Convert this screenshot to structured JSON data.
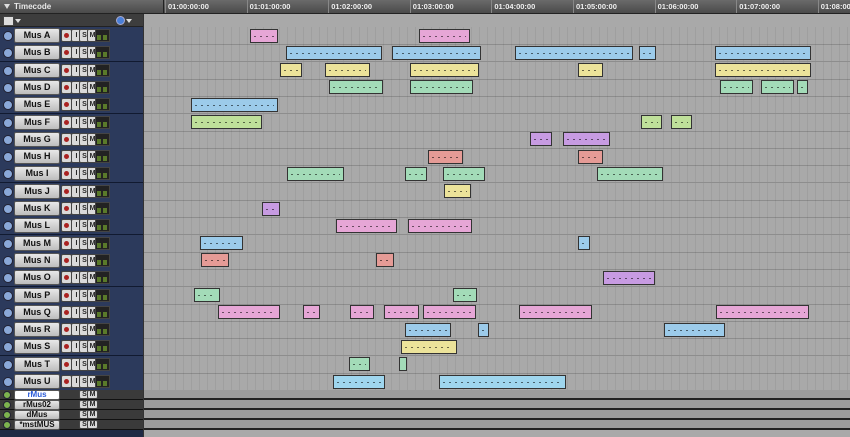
{
  "ruler": {
    "label": "Timecode",
    "ticks": [
      "01:00:00:00",
      "01:01:00:00",
      "01:02:00:00",
      "01:03:00:00",
      "01:04:00:00",
      "01:05:00:00",
      "01:06:00:00",
      "01:07:00:00",
      "01:08:00"
    ]
  },
  "track_buttons": {
    "input": "I",
    "solo": "S",
    "mute": "M"
  },
  "tracks": [
    {
      "name": "Mus A"
    },
    {
      "name": "Mus B"
    },
    {
      "name": "Mus C"
    },
    {
      "name": "Mus D"
    },
    {
      "name": "Mus E"
    },
    {
      "name": "Mus F"
    },
    {
      "name": "Mus G"
    },
    {
      "name": "Mus H"
    },
    {
      "name": "Mus I"
    },
    {
      "name": "Mus J"
    },
    {
      "name": "Mus K"
    },
    {
      "name": "Mus L"
    },
    {
      "name": "Mus M"
    },
    {
      "name": "Mus N"
    },
    {
      "name": "Mus O"
    },
    {
      "name": "Mus P"
    },
    {
      "name": "Mus Q"
    },
    {
      "name": "Mus R"
    },
    {
      "name": "Mus S"
    },
    {
      "name": "Mus T"
    },
    {
      "name": "Mus U"
    }
  ],
  "aux_tracks": [
    {
      "name": "rMus",
      "selected": true
    },
    {
      "name": "rMus02",
      "selected": false
    },
    {
      "name": "dMus",
      "selected": false
    },
    {
      "name": "*mstMUS",
      "selected": false
    }
  ],
  "colors": {
    "pink": "#e6a6d6",
    "blue": "#9ccbea",
    "yellow": "#ece39a",
    "green": "#a3dbb8",
    "lime": "#bfe09a",
    "purple": "#c79be2",
    "salmon": "#e59b96",
    "aqua": "#9fd6ee"
  },
  "clips": [
    {
      "track": 0,
      "start": 1.0,
      "end": 1.35,
      "color": "pink"
    },
    {
      "track": 0,
      "start": 3.07,
      "end": 3.7,
      "color": "pink"
    },
    {
      "track": 1,
      "start": 1.45,
      "end": 2.62,
      "color": "blue"
    },
    {
      "track": 1,
      "start": 2.74,
      "end": 3.83,
      "color": "blue"
    },
    {
      "track": 1,
      "start": 4.25,
      "end": 5.7,
      "color": "blue"
    },
    {
      "track": 1,
      "start": 5.77,
      "end": 5.98,
      "color": "blue"
    },
    {
      "track": 1,
      "start": 6.7,
      "end": 7.88,
      "color": "blue"
    },
    {
      "track": 2,
      "start": 1.37,
      "end": 1.64,
      "color": "yellow"
    },
    {
      "track": 2,
      "start": 1.93,
      "end": 2.48,
      "color": "yellow"
    },
    {
      "track": 2,
      "start": 2.96,
      "end": 3.81,
      "color": "yellow"
    },
    {
      "track": 2,
      "start": 5.03,
      "end": 5.33,
      "color": "yellow"
    },
    {
      "track": 2,
      "start": 6.7,
      "end": 7.88,
      "color": "yellow"
    },
    {
      "track": 3,
      "start": 1.97,
      "end": 2.63,
      "color": "green"
    },
    {
      "track": 3,
      "start": 2.97,
      "end": 3.74,
      "color": "green"
    },
    {
      "track": 3,
      "start": 6.77,
      "end": 7.17,
      "color": "green"
    },
    {
      "track": 3,
      "start": 7.27,
      "end": 7.67,
      "color": "green"
    },
    {
      "track": 3,
      "start": 7.71,
      "end": 7.84,
      "color": "green"
    },
    {
      "track": 4,
      "start": 0.28,
      "end": 1.35,
      "color": "blue"
    },
    {
      "track": 5,
      "start": 0.28,
      "end": 1.15,
      "color": "lime"
    },
    {
      "track": 5,
      "start": 5.8,
      "end": 6.05,
      "color": "lime"
    },
    {
      "track": 5,
      "start": 6.17,
      "end": 6.42,
      "color": "lime"
    },
    {
      "track": 6,
      "start": 4.44,
      "end": 4.71,
      "color": "purple"
    },
    {
      "track": 6,
      "start": 4.84,
      "end": 5.42,
      "color": "purple"
    },
    {
      "track": 7,
      "start": 3.19,
      "end": 3.62,
      "color": "salmon"
    },
    {
      "track": 7,
      "start": 5.03,
      "end": 5.33,
      "color": "salmon"
    },
    {
      "track": 8,
      "start": 1.46,
      "end": 2.16,
      "color": "green"
    },
    {
      "track": 8,
      "start": 2.9,
      "end": 3.18,
      "color": "green"
    },
    {
      "track": 8,
      "start": 3.37,
      "end": 3.89,
      "color": "green"
    },
    {
      "track": 8,
      "start": 5.26,
      "end": 6.07,
      "color": "green"
    },
    {
      "track": 9,
      "start": 3.38,
      "end": 3.71,
      "color": "yellow"
    },
    {
      "track": 10,
      "start": 1.15,
      "end": 1.37,
      "color": "purple"
    },
    {
      "track": 11,
      "start": 2.06,
      "end": 2.81,
      "color": "pink"
    },
    {
      "track": 11,
      "start": 2.94,
      "end": 3.72,
      "color": "pink"
    },
    {
      "track": 12,
      "start": 0.39,
      "end": 0.92,
      "color": "blue"
    },
    {
      "track": 12,
      "start": 5.03,
      "end": 5.17,
      "color": "blue"
    },
    {
      "track": 13,
      "start": 0.41,
      "end": 0.75,
      "color": "salmon"
    },
    {
      "track": 13,
      "start": 2.55,
      "end": 2.77,
      "color": "salmon"
    },
    {
      "track": 14,
      "start": 5.33,
      "end": 5.97,
      "color": "purple"
    },
    {
      "track": 15,
      "start": 0.32,
      "end": 0.64,
      "color": "green"
    },
    {
      "track": 15,
      "start": 3.49,
      "end": 3.79,
      "color": "green"
    },
    {
      "track": 16,
      "start": 0.61,
      "end": 1.37,
      "color": "pink"
    },
    {
      "track": 16,
      "start": 1.66,
      "end": 1.86,
      "color": "pink"
    },
    {
      "track": 16,
      "start": 2.23,
      "end": 2.52,
      "color": "pink"
    },
    {
      "track": 16,
      "start": 2.65,
      "end": 3.07,
      "color": "pink"
    },
    {
      "track": 16,
      "start": 3.12,
      "end": 3.78,
      "color": "pink"
    },
    {
      "track": 16,
      "start": 4.3,
      "end": 5.2,
      "color": "pink"
    },
    {
      "track": 16,
      "start": 6.72,
      "end": 7.85,
      "color": "pink"
    },
    {
      "track": 17,
      "start": 2.9,
      "end": 3.47,
      "color": "blue"
    },
    {
      "track": 17,
      "start": 3.8,
      "end": 3.93,
      "color": "blue"
    },
    {
      "track": 17,
      "start": 6.08,
      "end": 6.82,
      "color": "blue"
    },
    {
      "track": 18,
      "start": 2.86,
      "end": 3.54,
      "color": "yellow"
    },
    {
      "track": 19,
      "start": 2.22,
      "end": 2.48,
      "color": "green"
    },
    {
      "track": 19,
      "start": 2.83,
      "end": 2.93,
      "color": "green"
    },
    {
      "track": 20,
      "start": 2.02,
      "end": 2.66,
      "color": "aqua"
    },
    {
      "track": 20,
      "start": 3.32,
      "end": 4.88,
      "color": "aqua"
    }
  ]
}
